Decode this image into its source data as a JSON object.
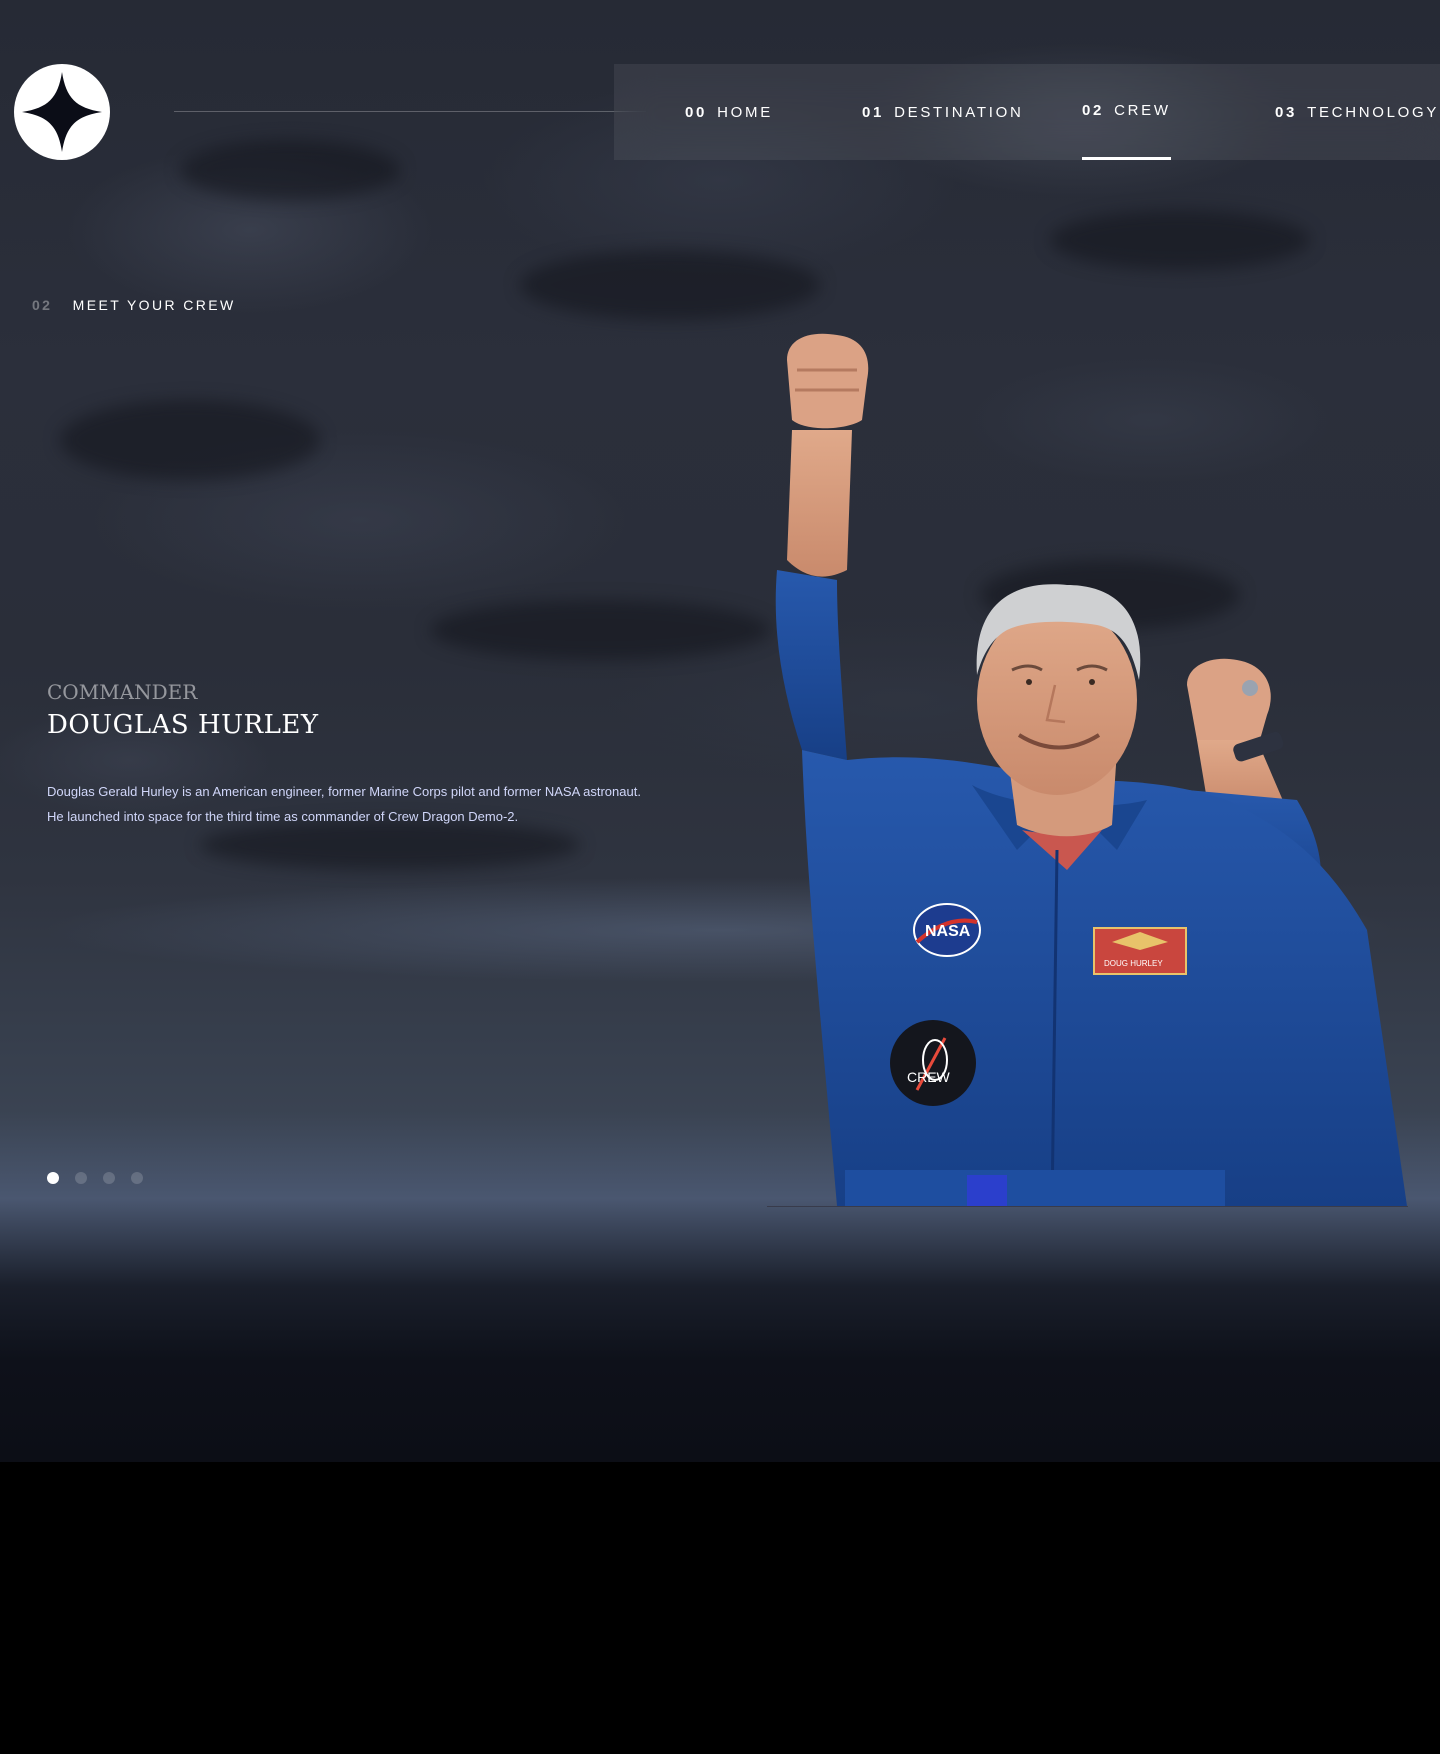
{
  "header": {
    "logo_icon": "star-logo-icon",
    "nav": [
      {
        "num": "00",
        "label": "HOME",
        "active": false
      },
      {
        "num": "01",
        "label": "DESTINATION",
        "active": false
      },
      {
        "num": "02",
        "label": "CREW",
        "active": true
      },
      {
        "num": "03",
        "label": "TECHNOLOGY",
        "active": false
      }
    ]
  },
  "eyebrow": {
    "num": "02",
    "label": "MEET YOUR CREW"
  },
  "crew": {
    "role": "Commander",
    "name": "Douglas Hurley",
    "bio": "Douglas Gerald Hurley is an American engineer, former Marine Corps pilot and former NASA astronaut. He launched into space for the third time as commander of Crew Dragon Demo-2.",
    "patch_nasa": "NASA",
    "patch_crew": "CREW",
    "name_tag": "DOUG HURLEY"
  },
  "slider": {
    "count": 4,
    "active_index": 0
  },
  "colors": {
    "background": "#0c0e16",
    "text_primary": "#ffffff",
    "text_body": "#d0d6f9",
    "dot_inactive": "rgba(255,255,255,0.17)",
    "suit_blue": "#1f4f9e"
  }
}
